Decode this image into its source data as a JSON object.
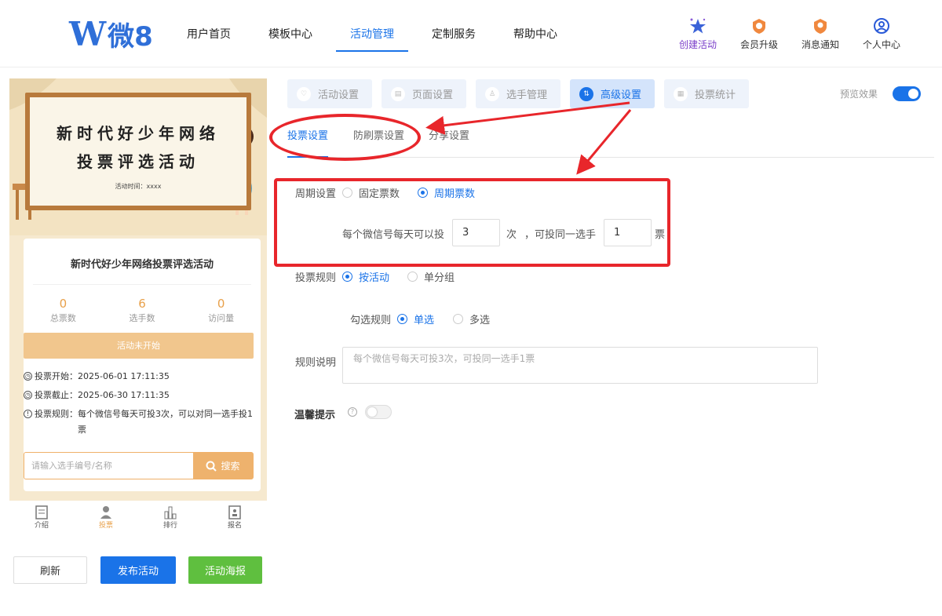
{
  "header": {
    "logo": {
      "mark": "W",
      "text": "微8"
    },
    "nav": [
      "用户首页",
      "模板中心",
      "活动管理",
      "定制服务",
      "帮助中心"
    ],
    "active_nav": "活动管理",
    "right": [
      "创建活动",
      "会员升级",
      "消息通知",
      "个人中心"
    ]
  },
  "preview": {
    "banner": {
      "line1": "新时代好少年网络",
      "line2": "投票评选活动",
      "time": "活动时间：xxxx"
    },
    "title": "新时代好少年网络投票评选活动",
    "stats": [
      {
        "value": "0",
        "label": "总票数"
      },
      {
        "value": "6",
        "label": "选手数"
      },
      {
        "value": "0",
        "label": "访问量"
      }
    ],
    "status": "活动未开始",
    "info": [
      {
        "label": "投票开始：",
        "value": "2025-06-01 17:11:35"
      },
      {
        "label": "投票截止：",
        "value": "2025-06-30 17:11:35"
      },
      {
        "label": "投票规则：",
        "value": "每个微信号每天可投3次，可以对同一选手投1票"
      }
    ],
    "search_placeholder": "请输入选手编号/名称",
    "search_button": "搜索",
    "tabbar": [
      "介绍",
      "投票",
      "排行",
      "报名"
    ],
    "active_tab": "投票"
  },
  "actions": {
    "refresh": "刷新",
    "publish": "发布活动",
    "poster": "活动海报"
  },
  "tabs": [
    "活动设置",
    "页面设置",
    "选手管理",
    "高级设置",
    "投票统计"
  ],
  "active_tab": "高级设置",
  "preview_toggle": {
    "label": "预览效果",
    "on": true
  },
  "subtabs": [
    "投票设置",
    "防刷票设置",
    "分享设置"
  ],
  "form": {
    "cycle": {
      "label": "周期设置",
      "options": [
        "固定票数",
        "周期票数"
      ],
      "selected": "周期票数"
    },
    "per_day_prefix": "每个微信号每天可以投",
    "per_day_value": "3",
    "per_day_unit": "次",
    "same_player_prefix": "，可投同一选手",
    "same_player_value": "1",
    "same_player_unit": "票",
    "rule": {
      "label": "投票规则",
      "options": [
        "按活动",
        "单分组"
      ],
      "selected": "按活动"
    },
    "select_rule": {
      "label": "勾选规则",
      "options": [
        "单选",
        "多选"
      ],
      "selected": "单选"
    },
    "description": {
      "label": "规则说明",
      "placeholder": "每个微信号每天可投3次，可投同一选手1票"
    },
    "tip": {
      "label": "温馨提示",
      "on": false
    }
  },
  "colors": {
    "primary": "#1a73e8",
    "annotation": "#e8262b",
    "orange": "#eeb26d",
    "green": "#5fbf3f"
  }
}
